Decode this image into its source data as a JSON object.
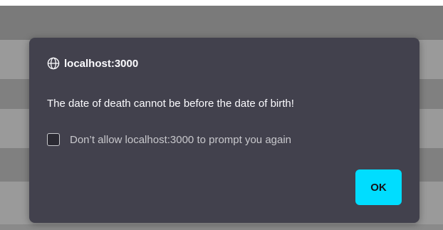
{
  "dialog": {
    "origin": "localhost:3000",
    "origin_icon": "globe-icon",
    "message": "The date of death cannot be before the date of birth!",
    "checkbox_label": "Don’t allow localhost:3000 to prompt you again",
    "checkbox_checked": false,
    "ok_label": "OK"
  },
  "colors": {
    "dialog_background": "#42414d",
    "accent": "#00ddff",
    "text": "#fbfbfe"
  }
}
